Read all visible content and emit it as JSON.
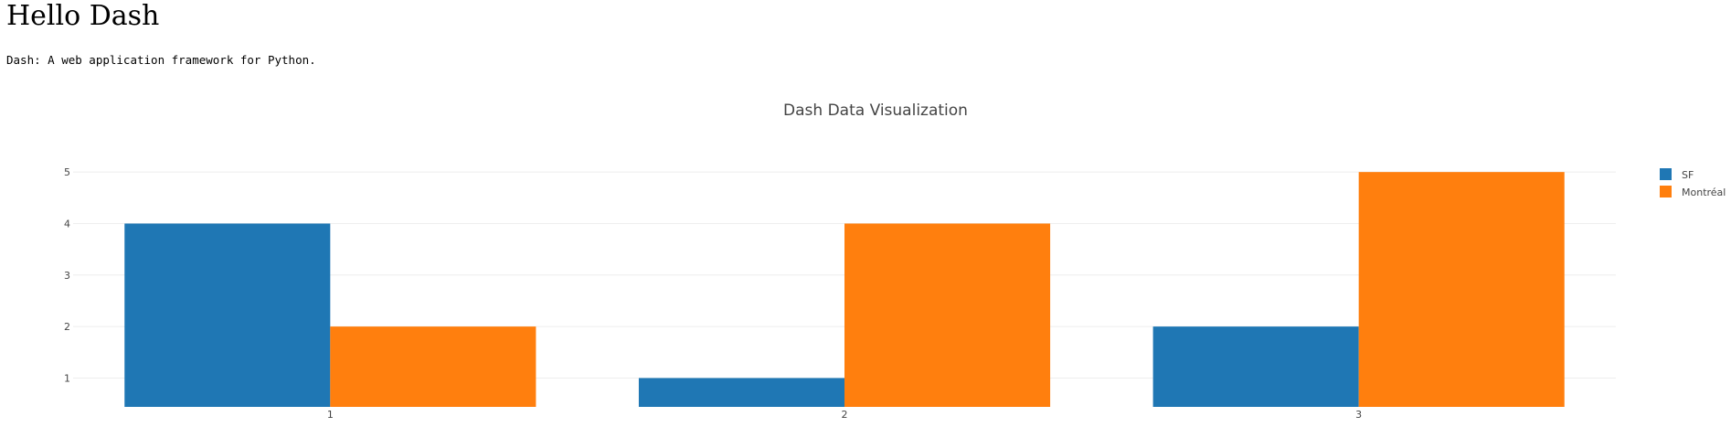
{
  "page": {
    "title": "Hello Dash",
    "subtitle": "Dash: A web application framework for Python."
  },
  "colors": {
    "sf": "#1f77b4",
    "montreal": "#ff7f0e",
    "grid": "#eeeeee",
    "text": "#444444"
  },
  "chart_data": {
    "type": "bar",
    "title": "Dash Data Visualization",
    "xlabel": "",
    "ylabel": "",
    "categories": [
      "1",
      "2",
      "3"
    ],
    "series": [
      {
        "name": "SF",
        "values": [
          4,
          1,
          2
        ],
        "color": "#1f77b4"
      },
      {
        "name": "Montréal",
        "values": [
          2,
          4,
          5
        ],
        "color": "#ff7f0e"
      }
    ],
    "yticks": [
      1,
      2,
      3,
      4,
      5
    ],
    "ylim": [
      0.44,
      5.5
    ],
    "grid": true,
    "legend": "top-right"
  }
}
